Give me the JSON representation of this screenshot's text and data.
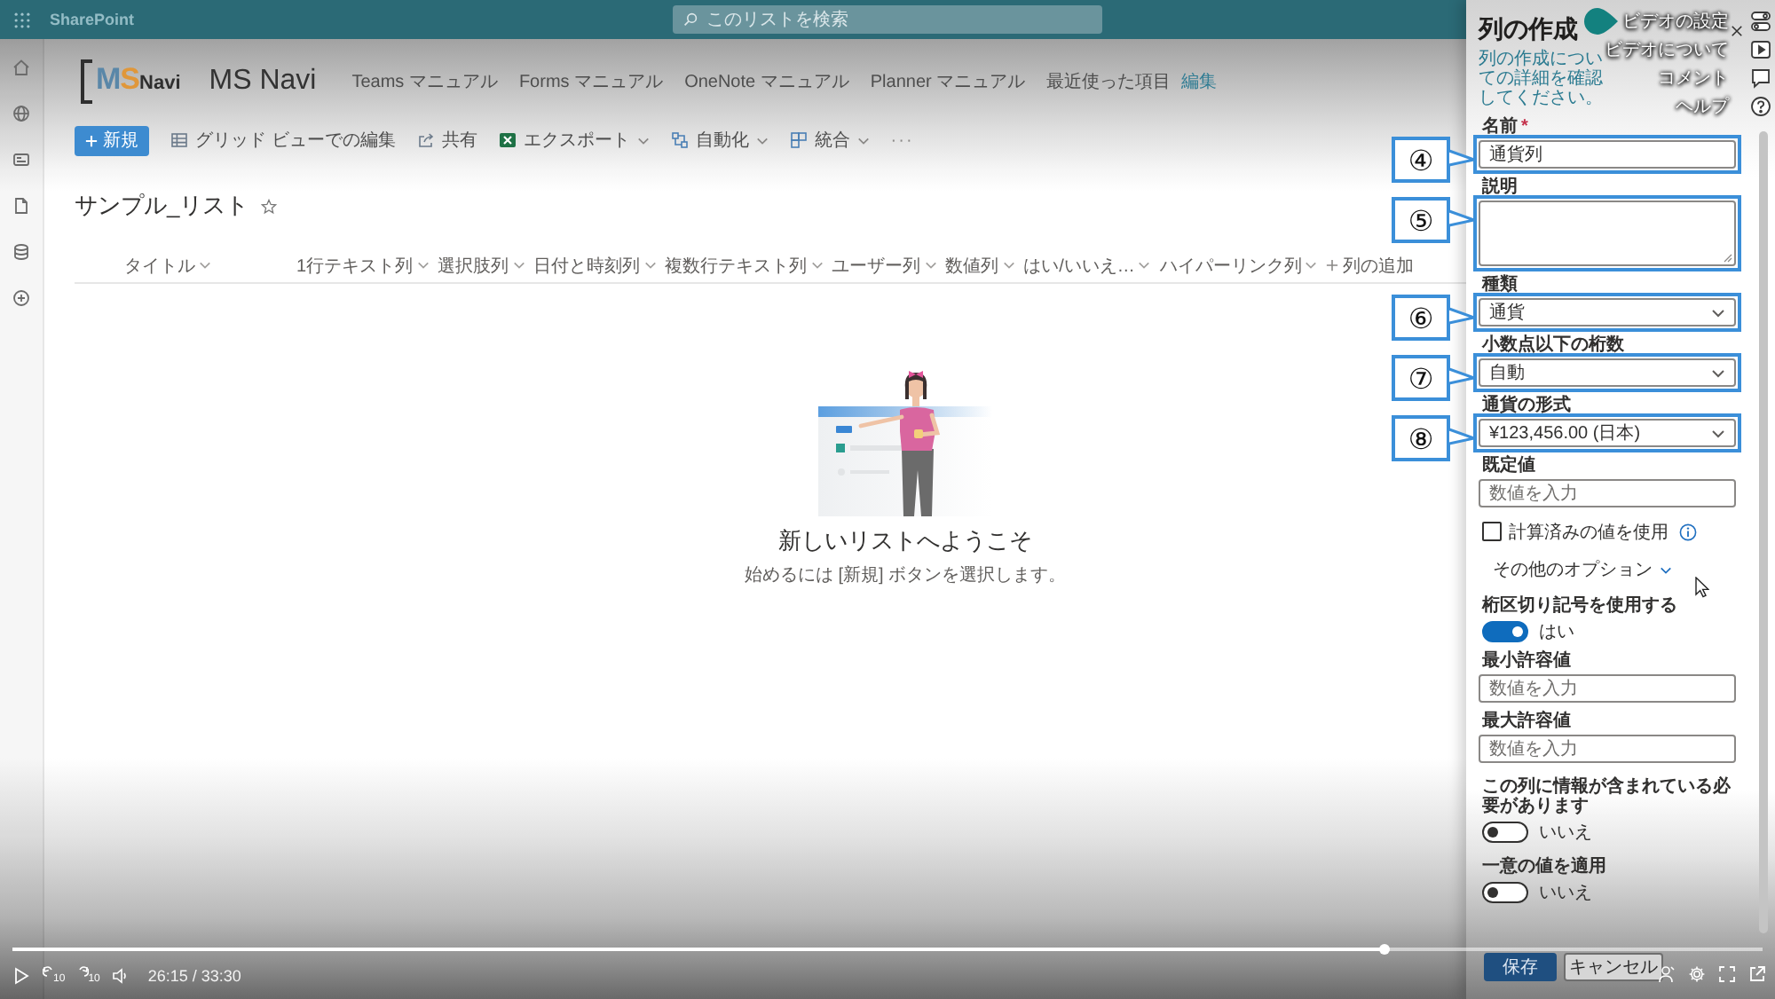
{
  "top_bar": {
    "app_name": "SharePoint",
    "search": {
      "placeholder": "このリストを検索"
    }
  },
  "site": {
    "logo": [
      {
        "text": "M",
        "color": "#5a87a8"
      },
      {
        "text": "S",
        "color": "#e0973a"
      },
      {
        "text": "Navi",
        "color": "#2f2f2f"
      }
    ],
    "title": "MS Navi",
    "nav": [
      {
        "label": "Teams マニュアル"
      },
      {
        "label": "Forms マニュアル"
      },
      {
        "label": "OneNote マニュアル"
      },
      {
        "label": "Planner マニュアル"
      },
      {
        "label": "最近使った項目"
      }
    ],
    "edit_link": "編集"
  },
  "command_bar": {
    "new_button": "新規",
    "commands": [
      {
        "kind": "grid",
        "label": "グリッド ビューでの編集",
        "dropdown": false
      },
      {
        "kind": "share",
        "label": "共有",
        "dropdown": false
      },
      {
        "kind": "excel",
        "label": "エクスポート",
        "dropdown": true
      },
      {
        "kind": "flow",
        "label": "自動化",
        "dropdown": true
      },
      {
        "kind": "integrate",
        "label": "統合",
        "dropdown": true
      }
    ],
    "more": "···"
  },
  "list": {
    "title": "サンプル_リスト",
    "favorite": false,
    "columns": [
      {
        "label": "タイトル"
      },
      {
        "label": "1行テキスト列"
      },
      {
        "label": "選択肢列"
      },
      {
        "label": "日付と時刻列"
      },
      {
        "label": "複数行テキスト列"
      },
      {
        "label": "ユーザー列"
      },
      {
        "label": "数値列"
      },
      {
        "label": "はい/いいえ…"
      },
      {
        "label": "ハイパーリンク列"
      }
    ],
    "add_column": "列の追加"
  },
  "empty_state": {
    "heading": "新しいリストへようこそ",
    "hint": "始めるには [新規] ボタンを選択します。"
  },
  "panel": {
    "title": "列の作成",
    "description": "列の作成についての詳細を確認してください。",
    "fields": [
      {
        "kind": "text",
        "label": "名前",
        "required_mark": "*",
        "value": "通貨列",
        "callout": "④"
      },
      {
        "kind": "textarea",
        "label": "説明",
        "callout": "⑤"
      },
      {
        "kind": "select",
        "label": "種類",
        "value": "通貨",
        "callout": "⑥"
      },
      {
        "kind": "select",
        "label": "小数点以下の桁数",
        "value": "自動",
        "callout": "⑦"
      },
      {
        "kind": "select",
        "label": "通貨の形式",
        "value": "¥123,456.00 (日本)",
        "callout": "⑧"
      },
      {
        "kind": "text",
        "label": "既定値",
        "placeholder": "数値を入力"
      },
      {
        "kind": "checkbox",
        "label": "計算済みの値を使用",
        "checked": false
      },
      {
        "kind": "expander",
        "label": "その他のオプション"
      },
      {
        "kind": "toggle",
        "label": "桁区切り記号を使用する",
        "on": true,
        "state_text": "はい"
      },
      {
        "kind": "text",
        "label": "最小許容値",
        "placeholder": "数値を入力"
      },
      {
        "kind": "text",
        "label": "最大許容値",
        "placeholder": "数値を入力"
      },
      {
        "kind": "toggle",
        "label": "この列に情報が含まれている必要があります",
        "on": false,
        "state_text": "いいえ"
      },
      {
        "kind": "toggle",
        "label": "一意の値を適用",
        "on": false,
        "state_text": "いいえ"
      }
    ],
    "save_button": "保存",
    "cancel_button": "キャンセル"
  },
  "video_menu": [
    {
      "kind": "settings",
      "label": "ビデオの設定"
    },
    {
      "kind": "about",
      "label": "ビデオについて"
    },
    {
      "kind": "comment",
      "label": "コメント"
    },
    {
      "kind": "help",
      "label": "ヘルプ"
    }
  ],
  "player": {
    "progress": {
      "level": 0.784
    },
    "skip_back": "10",
    "skip_forward": "10",
    "time": "26:15 / 33:30"
  }
}
